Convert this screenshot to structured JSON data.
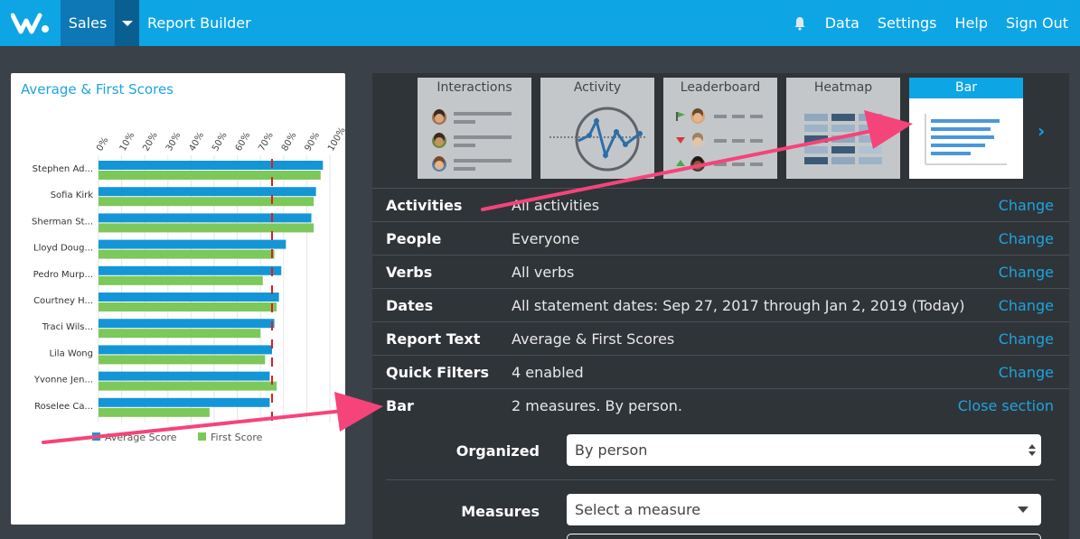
{
  "nav": {
    "sales": "Sales",
    "report_builder": "Report Builder",
    "data": "Data",
    "settings": "Settings",
    "help": "Help",
    "sign_out": "Sign Out"
  },
  "chart": {
    "title": "Average & First Scores"
  },
  "chart_data": {
    "type": "bar",
    "orientation": "horizontal",
    "title": "Average & First Scores",
    "xaxis_ticks": [
      "0%",
      "10%",
      "20%",
      "30%",
      "40%",
      "50%",
      "60%",
      "70%",
      "80%",
      "90%",
      "100%"
    ],
    "xlim": [
      0,
      100
    ],
    "reference_line": 75,
    "categories": [
      "Stephen Ad...",
      "Sofia Kirk",
      "Sherman St...",
      "Lloyd Doug...",
      "Pedro Murp...",
      "Courtney H...",
      "Traci Wils...",
      "Lila Wong",
      "Yvonne Jen...",
      "Roselee Ca..."
    ],
    "series": [
      {
        "name": "Average Score",
        "color": "#1496d6",
        "values": [
          97,
          94,
          92,
          81,
          79,
          78,
          76,
          75,
          74,
          74
        ]
      },
      {
        "name": "First Score",
        "color": "#7cc85a",
        "values": [
          96,
          93,
          93,
          76,
          71,
          77,
          70,
          72,
          77,
          48
        ]
      }
    ],
    "legend_position": "bottom"
  },
  "tiles": [
    {
      "label": "Interactions",
      "icon": "interactions-thumbnail"
    },
    {
      "label": "Activity",
      "icon": "activity-thumbnail"
    },
    {
      "label": "Leaderboard",
      "icon": "leaderboard-thumbnail"
    },
    {
      "label": "Heatmap",
      "icon": "heatmap-thumbnail"
    },
    {
      "label": "Bar",
      "icon": "bar-thumbnail",
      "active": true
    }
  ],
  "rows": [
    {
      "label": "Activities",
      "value": "All activities",
      "action": "Change"
    },
    {
      "label": "People",
      "value": "Everyone",
      "action": "Change"
    },
    {
      "label": "Verbs",
      "value": "All verbs",
      "action": "Change"
    },
    {
      "label": "Dates",
      "value": "All statement dates: Sep 27, 2017 through Jan 2, 2019 (Today)",
      "action": "Change"
    },
    {
      "label": "Report Text",
      "value": "Average & First Scores",
      "action": "Change"
    },
    {
      "label": "Quick Filters",
      "value": "4 enabled",
      "action": "Change"
    },
    {
      "label": "Bar",
      "value": "2 measures. By person.",
      "action": "Close section"
    }
  ],
  "form": {
    "organized_label": "Organized",
    "organized_value": "By person",
    "measures_label": "Measures",
    "measures_placeholder": "Select a measure"
  },
  "colors": {
    "accent": "#0ea5e5",
    "annotation_arrow": "#f5447a"
  }
}
